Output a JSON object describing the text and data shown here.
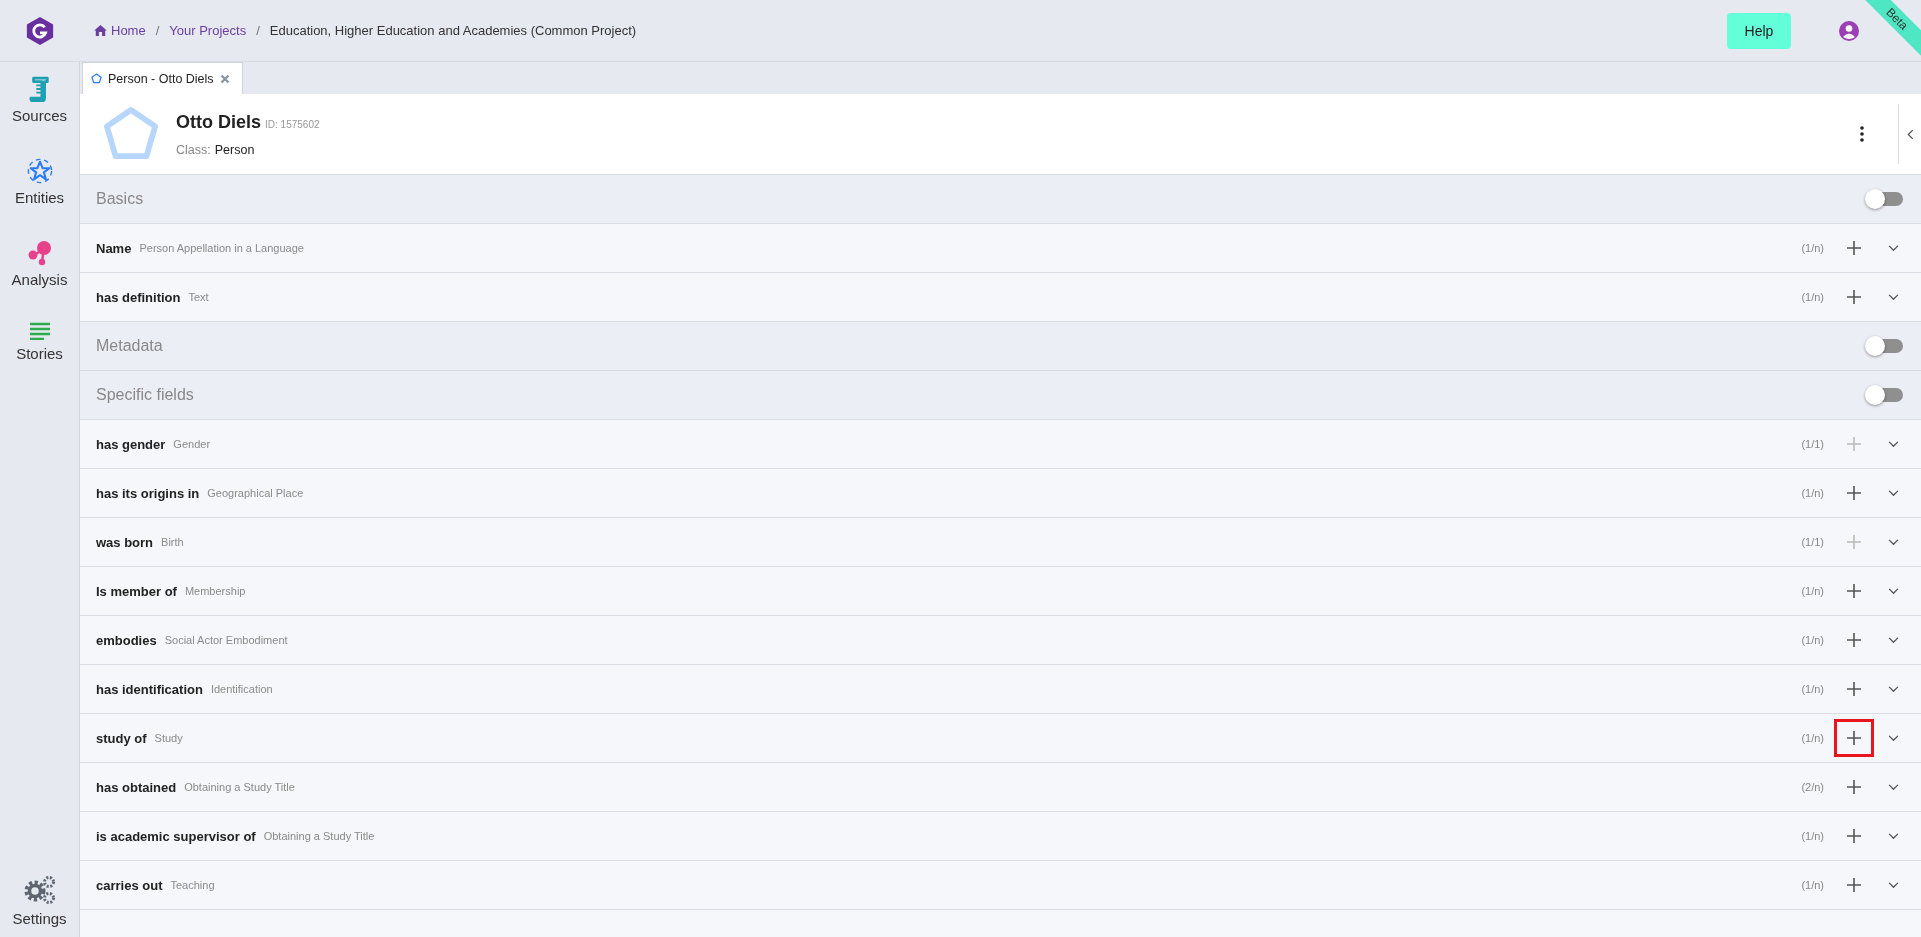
{
  "breadcrumb": [
    {
      "label": "Home",
      "link": true
    },
    {
      "label": "Your Projects",
      "link": true
    },
    {
      "label": "Education, Higher Education and Academies (Common Project)",
      "link": false
    }
  ],
  "breadcrumb_separator": "/",
  "help_button": "Help",
  "ribbon": "Beta",
  "sidebar": {
    "items": [
      {
        "label": "Sources",
        "kind": "sources"
      },
      {
        "label": "Entities",
        "kind": "entities"
      },
      {
        "label": "Analysis",
        "kind": "analysis"
      },
      {
        "label": "Stories",
        "kind": "stories"
      }
    ],
    "settings": "Settings"
  },
  "tabs": [
    {
      "label": "Person - Otto Diels",
      "selected": true
    }
  ],
  "entity": {
    "name": "Otto Diels",
    "id": "ID: 1575602",
    "class_label": "Class:",
    "class_value": "Person"
  },
  "rows": [
    {
      "kind": "section",
      "title": "Basics",
      "on": false
    },
    {
      "kind": "field",
      "label": "Name",
      "target": "Person Appellation in a Language",
      "quantity": "(1/n)",
      "add_disabled": false,
      "highlighted": false
    },
    {
      "kind": "field",
      "label": "has definition",
      "target": "Text",
      "quantity": "(1/n)",
      "add_disabled": false,
      "highlighted": false
    },
    {
      "kind": "section",
      "title": "Metadata",
      "on": false
    },
    {
      "kind": "section",
      "title": "Specific fields",
      "on": false
    },
    {
      "kind": "field",
      "label": "has gender",
      "target": "Gender",
      "quantity": "(1/1)",
      "add_disabled": true,
      "highlighted": false
    },
    {
      "kind": "field",
      "label": "has its origins in",
      "target": "Geographical Place",
      "quantity": "(1/n)",
      "add_disabled": false,
      "highlighted": false
    },
    {
      "kind": "field",
      "label": "was born",
      "target": "Birth",
      "quantity": "(1/1)",
      "add_disabled": true,
      "highlighted": false
    },
    {
      "kind": "field",
      "label": "Is member of",
      "target": "Membership",
      "quantity": "(1/n)",
      "add_disabled": false,
      "highlighted": false
    },
    {
      "kind": "field",
      "label": "embodies",
      "target": "Social Actor Embodiment",
      "quantity": "(1/n)",
      "add_disabled": false,
      "highlighted": false
    },
    {
      "kind": "field",
      "label": "has identification",
      "target": "Identification",
      "quantity": "(1/n)",
      "add_disabled": false,
      "highlighted": false
    },
    {
      "kind": "field",
      "label": "study of",
      "target": "Study",
      "quantity": "(1/n)",
      "add_disabled": false,
      "highlighted": true
    },
    {
      "kind": "field",
      "label": "has obtained",
      "target": "Obtaining a Study Title",
      "quantity": "(2/n)",
      "add_disabled": false,
      "highlighted": false
    },
    {
      "kind": "field",
      "label": "is academic supervisor of",
      "target": "Obtaining a Study Title",
      "quantity": "(1/n)",
      "add_disabled": false,
      "highlighted": false
    },
    {
      "kind": "field",
      "label": "carries out",
      "target": "Teaching",
      "quantity": "(1/n)",
      "add_disabled": false,
      "highlighted": false
    }
  ]
}
